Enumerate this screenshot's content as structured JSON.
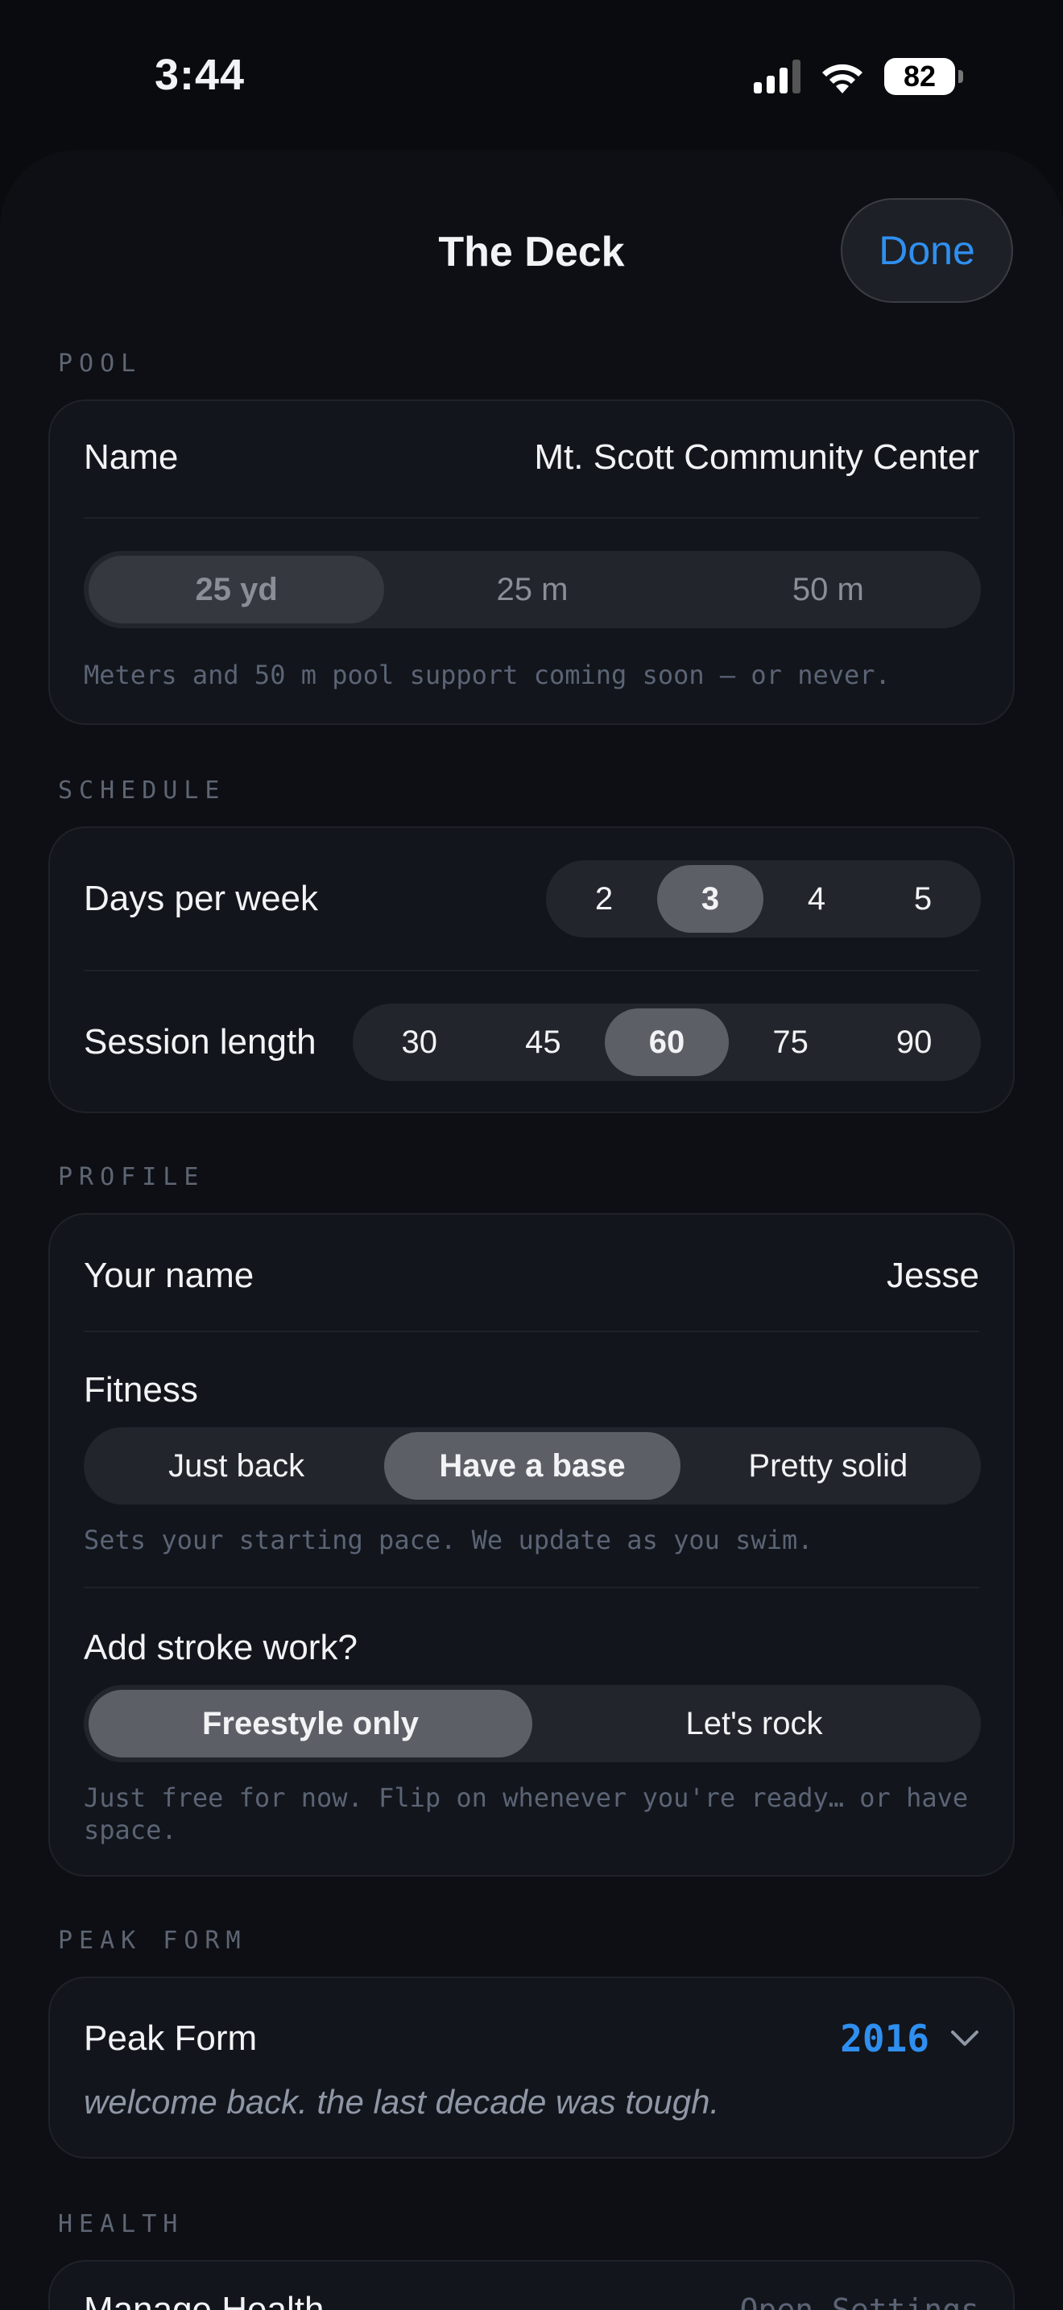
{
  "status_bar": {
    "time": "3:44",
    "battery": "82"
  },
  "header": {
    "title": "The Deck",
    "done_label": "Done"
  },
  "pool": {
    "section_label": "POOL",
    "name_label": "Name",
    "name_value": "Mt. Scott Community Center",
    "units": [
      "25 yd",
      "25 m",
      "50 m"
    ],
    "selected_unit": "25 yd",
    "note": "Meters and 50 m pool support coming soon — or never."
  },
  "schedule": {
    "section_label": "SCHEDULE",
    "days_label": "Days per week",
    "days_options": [
      "2",
      "3",
      "4",
      "5"
    ],
    "days_selected": "3",
    "session_label": "Session length",
    "session_options": [
      "30",
      "45",
      "60",
      "75",
      "90"
    ],
    "session_selected": "60"
  },
  "profile": {
    "section_label": "PROFILE",
    "name_label": "Your name",
    "name_value": "Jesse",
    "fitness_label": "Fitness",
    "fitness_options": [
      "Just back",
      "Have a base",
      "Pretty solid"
    ],
    "fitness_selected": "Have a base",
    "fitness_note": "Sets your starting pace. We update as you swim.",
    "stroke_label": "Add stroke work?",
    "stroke_options": [
      "Freestyle only",
      "Let's rock"
    ],
    "stroke_selected": "Freestyle only",
    "stroke_note": "Just free for now. Flip on whenever you're ready… or have space."
  },
  "peak_form": {
    "section_label": "PEAK FORM",
    "label": "Peak Form",
    "year": "2016",
    "subtitle": "welcome back. the last decade was tough."
  },
  "health": {
    "section_label": "HEALTH",
    "row_label": "Manage Health",
    "row_value": "Open Settings"
  },
  "colors": {
    "accent": "#2f8ff0",
    "background": "#0a0b0f",
    "card": "#12151b"
  },
  "icons": {
    "peak_form_toggle": "chevron-down-icon",
    "wifi": "wifi-icon",
    "signal": "cellular-signal-icon",
    "battery": "battery-icon"
  }
}
